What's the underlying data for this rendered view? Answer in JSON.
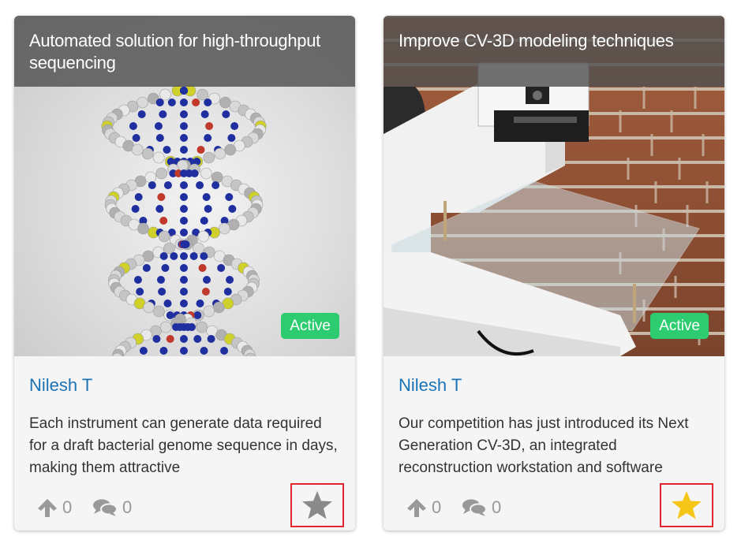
{
  "cards": [
    {
      "title": "Automated solution for high-throughput sequencing",
      "status": "Active",
      "author": "Nilesh T",
      "description": "Each instrument can generate data required for a draft bacterial genome sequence in days, making them attractive",
      "upvotes": "0",
      "comments": "0",
      "favorite": false,
      "image": "dna-double-helix-image"
    },
    {
      "title": "Improve CV-3D modeling techniques",
      "status": "Active",
      "author": "Nilesh T",
      "description": "Our competition has just introduced its Next Generation CV-3D, an integrated reconstruction workstation and software",
      "upvotes": "0",
      "comments": "0",
      "favorite": true,
      "image": "3d-scanner-device-image"
    }
  ],
  "colors": {
    "badge": "#2ecc71",
    "author_link": "#1a73b5",
    "star_inactive": "#8a8a8a",
    "star_active": "#f5c518",
    "highlight_border": "#e0262e"
  },
  "icons": {
    "upvote": "arrow-up-icon",
    "comments": "comments-icon",
    "favorite": "star-icon"
  }
}
